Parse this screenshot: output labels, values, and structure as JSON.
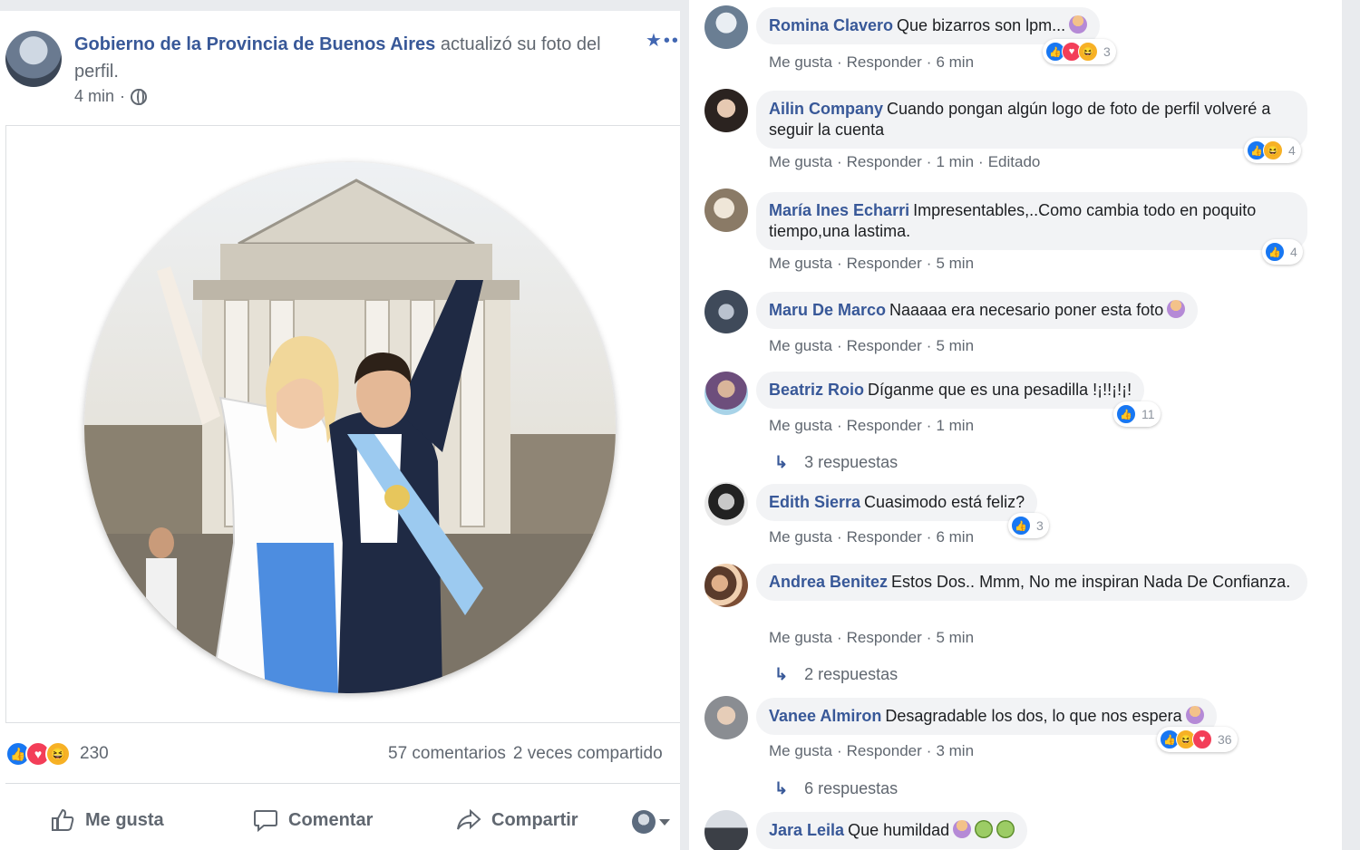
{
  "post": {
    "page_name": "Gobierno de la Provincia de Buenos Aires",
    "action_text": " actualizó su foto del perfil.",
    "time": "4 min",
    "separator": "·",
    "reactions_count": "230",
    "comments_count": "57 comentarios",
    "shares_count": "2 veces compartido",
    "actions": {
      "like": "Me gusta",
      "comment": "Comentar",
      "share": "Compartir"
    },
    "icons": {
      "privacy": "globe-icon",
      "more": "star-more-icon"
    }
  },
  "comment_actions": {
    "like": "Me gusta",
    "reply": "Responder",
    "sep": "·"
  },
  "colors": {
    "link": "#385898",
    "like": "#1877f2",
    "love": "#f33e58",
    "haha": "#f7b125"
  },
  "comments": [
    {
      "name": "Romina Clavero",
      "text": "Que bizarros son lpm...",
      "time": "6 min",
      "edited": "",
      "reactions": [
        "like",
        "love",
        "haha"
      ],
      "count": "3",
      "replies": ""
    },
    {
      "name": "Ailin Company",
      "text": "Cuando pongan algún logo de foto de perfil volveré a seguir la cuenta",
      "time": "1 min",
      "edited": "Editado",
      "reactions": [
        "like",
        "haha"
      ],
      "count": "4",
      "replies": ""
    },
    {
      "name": "María Ines Echarri",
      "text": "Impresentables,..Como cambia todo en poquito tiempo,una lastima.",
      "time": "5 min",
      "edited": "",
      "reactions": [
        "like"
      ],
      "count": "4",
      "replies": ""
    },
    {
      "name": "Maru De Marco",
      "text": "Naaaaa era necesario poner esta foto",
      "time": "5 min",
      "edited": "",
      "reactions": [],
      "count": "",
      "replies": ""
    },
    {
      "name": "Beatriz Roio",
      "text": "Díganme que es una pesadilla !¡!!¡!¡!",
      "time": "1 min",
      "edited": "",
      "reactions": [
        "like"
      ],
      "count": "11",
      "replies": "3 respuestas"
    },
    {
      "name": "Edith Sierra",
      "text": "Cuasimodo está feliz?",
      "time": "6 min",
      "edited": "",
      "reactions": [
        "like"
      ],
      "count": "3",
      "replies": ""
    },
    {
      "name": "Andrea Benitez",
      "text": "Estos Dos.. Mmm, No me inspiran Nada De Confianza.",
      "time": "5 min",
      "edited": "",
      "reactions": [],
      "count": "",
      "replies": "2 respuestas"
    },
    {
      "name": "Vanee Almiron",
      "text": "Desagradable los dos, lo que nos espera",
      "time": "3 min",
      "edited": "",
      "reactions": [
        "like",
        "haha",
        "love"
      ],
      "count": "36",
      "replies": "6 respuestas"
    },
    {
      "name": "Jara Leila",
      "text": "Que humildad",
      "time": "",
      "edited": "",
      "reactions": [],
      "count": "",
      "replies": ""
    }
  ]
}
